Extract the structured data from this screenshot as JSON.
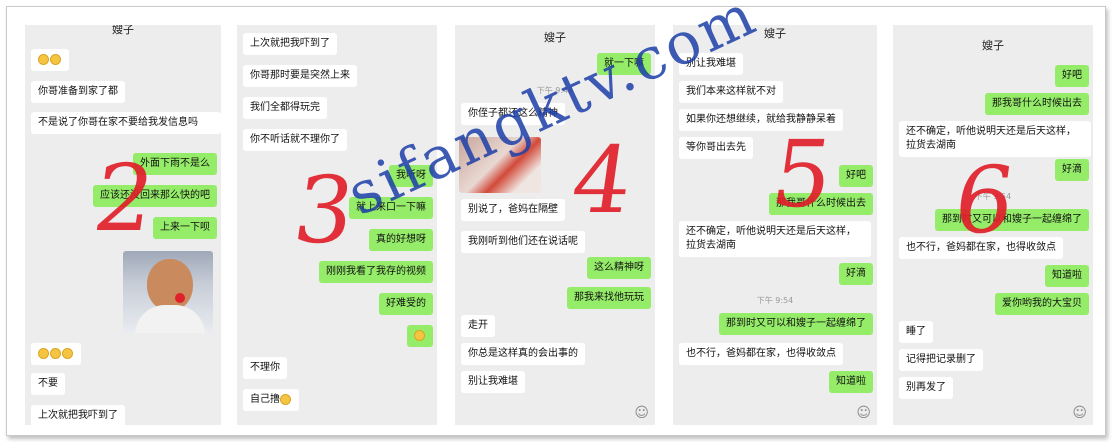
{
  "panels": [
    {
      "title": "嫂子",
      "digit": "2",
      "messages": [
        {
          "side": "in",
          "text": ""
        },
        {
          "side": "in",
          "text": "你哥准备到家了都"
        },
        {
          "side": "in",
          "text": "不是说了你哥在家不要给我发信息吗"
        },
        {
          "side": "out",
          "text": "外面下雨不是么"
        },
        {
          "side": "out",
          "text": "应该还没回来那么快的吧"
        },
        {
          "side": "out",
          "text": "上来一下呗"
        },
        {
          "side": "in",
          "text": ""
        },
        {
          "side": "in",
          "text": "不要"
        },
        {
          "side": "in",
          "text": "上次就把我吓到了"
        }
      ]
    },
    {
      "title": "",
      "digit": "3",
      "messages": [
        {
          "side": "in",
          "text": "上次就把我吓到了"
        },
        {
          "side": "in",
          "text": "你哥那时要是突然上来"
        },
        {
          "side": "in",
          "text": "我们全都得玩完"
        },
        {
          "side": "in",
          "text": "你不听话就不理你了"
        },
        {
          "side": "out",
          "text": "我听呀"
        },
        {
          "side": "out",
          "text": "就上来口一下嘛"
        },
        {
          "side": "out",
          "text": "真的好想呀"
        },
        {
          "side": "out",
          "text": "刚刚我看了我存的视频"
        },
        {
          "side": "out",
          "text": "好难受的"
        },
        {
          "side": "in",
          "text": "不理你"
        },
        {
          "side": "in",
          "text": "自己撸"
        }
      ]
    },
    {
      "title": "嫂子",
      "digit": "4",
      "time": "下午 9:49",
      "messages": [
        {
          "side": "out",
          "text": "就一下嘛"
        },
        {
          "side": "in",
          "text": "你侄子都还这么精神"
        },
        {
          "side": "in",
          "text": "别说了，爸妈在隔壁"
        },
        {
          "side": "in",
          "text": "我刚听到他们还在说话呢"
        },
        {
          "side": "out",
          "text": "这么精神呀"
        },
        {
          "side": "out",
          "text": "那我来找他玩玩"
        },
        {
          "side": "in",
          "text": "走开"
        },
        {
          "side": "in",
          "text": "你总是这样真的会出事的"
        },
        {
          "side": "in",
          "text": "别让我难堪"
        }
      ]
    },
    {
      "title": "嫂子",
      "digit": "5",
      "time": "下午 9:54",
      "messages": [
        {
          "side": "in",
          "text": "别让我难堪"
        },
        {
          "side": "in",
          "text": "我们本来这样就不对"
        },
        {
          "side": "in",
          "text": "如果你还想继续，就给我静静呆着"
        },
        {
          "side": "in",
          "text": "等你哥出去先"
        },
        {
          "side": "out",
          "text": "好吧"
        },
        {
          "side": "out",
          "text": "那我哥什么时候出去"
        },
        {
          "side": "in",
          "text": "还不确定，听他说明天还是后天这样，拉货去湖南"
        },
        {
          "side": "out",
          "text": "好滴"
        },
        {
          "side": "out",
          "text": "那到时又可以和嫂子一起缠绵了"
        },
        {
          "side": "in",
          "text": "也不行，爸妈都在家，也得收敛点"
        },
        {
          "side": "out",
          "text": "知道啦"
        }
      ]
    },
    {
      "title": "嫂子",
      "digit": "6",
      "time": "下午 9:54",
      "messages": [
        {
          "side": "out",
          "text": "好吧"
        },
        {
          "side": "out",
          "text": "那我哥什么时候出去"
        },
        {
          "side": "in",
          "text": "还不确定，听他说明天还是后天这样，拉货去湖南"
        },
        {
          "side": "out",
          "text": "好滴"
        },
        {
          "side": "out",
          "text": "那到时又可以和嫂子一起缠绵了"
        },
        {
          "side": "in",
          "text": "也不行，爸妈都在家，也得收敛点"
        },
        {
          "side": "out",
          "text": "知道啦"
        },
        {
          "side": "out",
          "text": "爱你哟我的大宝贝"
        },
        {
          "side": "in",
          "text": "睡了"
        },
        {
          "side": "in",
          "text": "记得把记录删了"
        },
        {
          "side": "in",
          "text": "别再发了"
        }
      ]
    }
  ],
  "watermark": "sifangktv.com",
  "colors": {
    "sent": "#95ec69",
    "received": "#ffffff",
    "background": "#ededed",
    "annotation": "#e0202a",
    "watermark": "#1d3fa8"
  }
}
